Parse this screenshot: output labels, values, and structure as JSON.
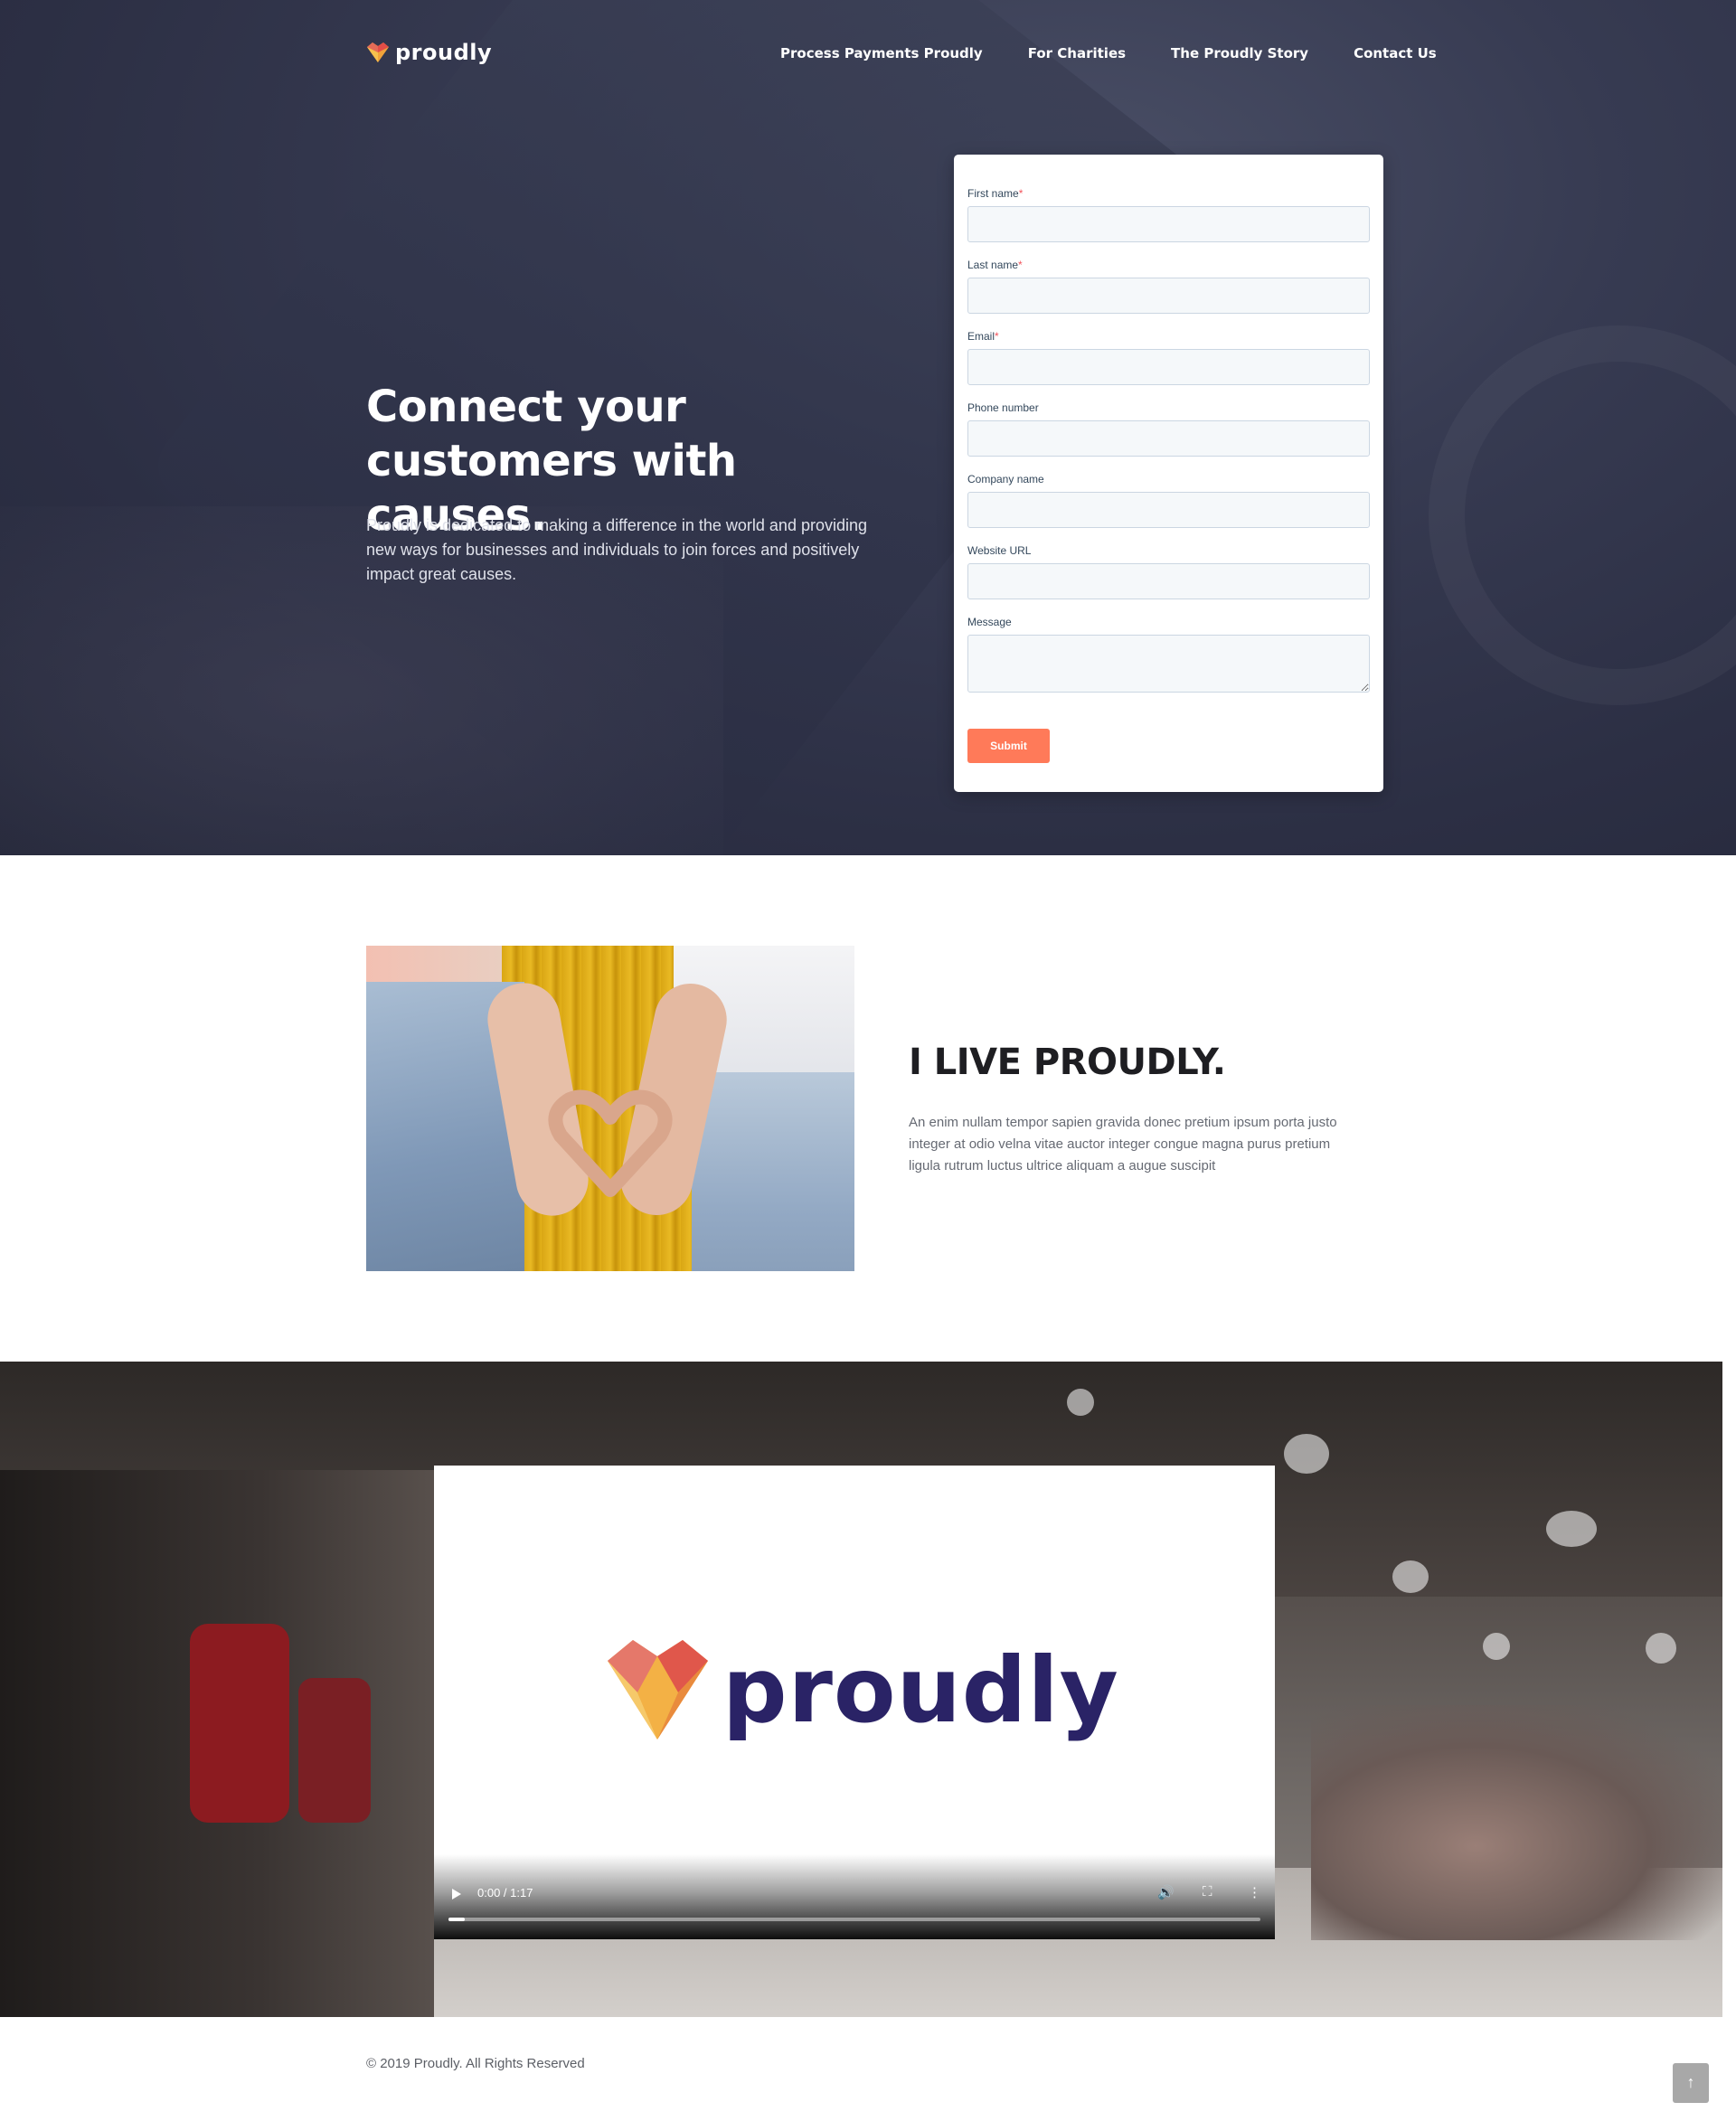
{
  "brand": {
    "name": "proudly"
  },
  "nav": {
    "items": [
      {
        "label": "Process Payments Proudly"
      },
      {
        "label": "For Charities"
      },
      {
        "label": "The Proudly Story"
      },
      {
        "label": "Contact Us"
      }
    ]
  },
  "hero": {
    "title_line1": "Connect your",
    "title_line2": "customers with causes.",
    "description": "Proudly is dedicated to making a difference in the world and providing new ways for businesses and individuals to join forces and positively impact great causes."
  },
  "form": {
    "fields": [
      {
        "label": "First name",
        "required": "*",
        "value": ""
      },
      {
        "label": "Last name",
        "required": "*",
        "value": ""
      },
      {
        "label": "Email",
        "required": "*",
        "value": ""
      },
      {
        "label": "Phone number",
        "value": ""
      },
      {
        "label": "Company name",
        "value": ""
      },
      {
        "label": "Website URL",
        "value": ""
      },
      {
        "label": "Message",
        "value": ""
      }
    ],
    "submit_label": "Submit",
    "submit_color": "#ff7a59",
    "required_color": "#f2545b"
  },
  "live": {
    "title": "I LIVE PROUDLY.",
    "description": "An enim nullam tempor sapien gravida donec pretium ipsum porta justo integer at odio velna vitae auctor integer congue magna purus pretium ligula rutrum luctus ultrice aliquam a augue suscipit"
  },
  "video": {
    "logo_text": "proudly",
    "logo_color": "#2a2366",
    "time": "0:00 / 1:17",
    "progress": 0.02,
    "icons": {
      "play": "play-icon",
      "volume": "volume-icon",
      "fullscreen": "fullscreen-icon",
      "more": "more-options-icon"
    }
  },
  "footer": {
    "copyright": "© 2019 Proudly. All Rights Reserved",
    "back_to_top_icon": "arrow-up-icon"
  }
}
